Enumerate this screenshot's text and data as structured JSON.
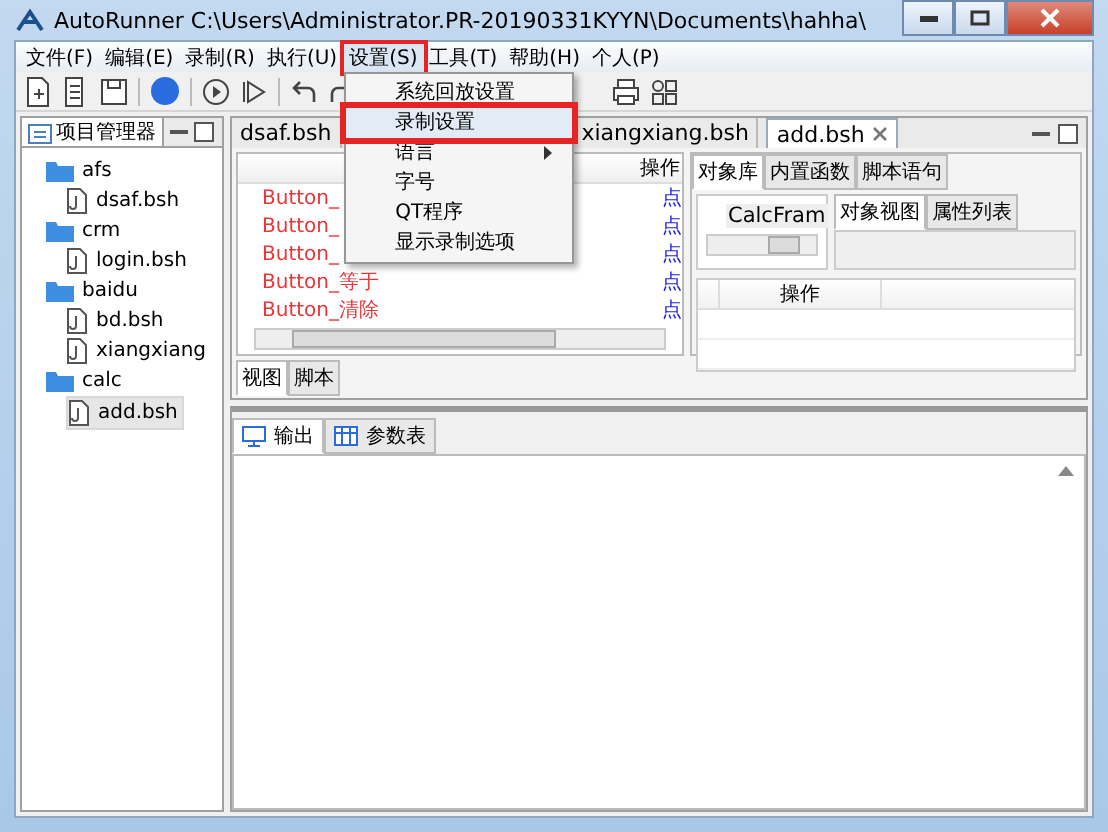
{
  "window": {
    "title": "AutoRunner  C:\\Users\\Administrator.PR-20190331KYYN\\Documents\\hahha\\"
  },
  "menu_bar": [
    {
      "label": "文件(F)",
      "selected": false
    },
    {
      "label": "编辑(E)",
      "selected": false
    },
    {
      "label": "录制(R)",
      "selected": false
    },
    {
      "label": "执行(U)",
      "selected": false
    },
    {
      "label": "设置(S)",
      "selected": true
    },
    {
      "label": "工具(T)",
      "selected": false
    },
    {
      "label": "帮助(H)",
      "selected": false
    },
    {
      "label": "个人(P)",
      "selected": false
    }
  ],
  "dropdown": [
    {
      "label": "系统回放设置",
      "selected": false,
      "submenu": false
    },
    {
      "label": "录制设置",
      "selected": true,
      "submenu": false
    },
    {
      "label": "语言",
      "selected": false,
      "submenu": true
    },
    {
      "label": "字号",
      "selected": false,
      "submenu": false
    },
    {
      "label": "QT程序",
      "selected": false,
      "submenu": false
    },
    {
      "label": "显示录制选项",
      "selected": false,
      "submenu": false
    }
  ],
  "project_panel": {
    "title": "项目管理器",
    "tree": [
      {
        "label": "afs",
        "kind": "folder",
        "selected": false,
        "children": [
          {
            "label": "dsaf.bsh",
            "kind": "file",
            "selected": false
          }
        ]
      },
      {
        "label": "crm",
        "kind": "folder",
        "selected": false,
        "children": [
          {
            "label": "login.bsh",
            "kind": "file",
            "selected": false
          }
        ]
      },
      {
        "label": "baidu",
        "kind": "folder",
        "selected": false,
        "children": [
          {
            "label": "bd.bsh",
            "kind": "file",
            "selected": false
          },
          {
            "label": "xiangxiang",
            "kind": "file",
            "selected": false
          }
        ]
      },
      {
        "label": "calc",
        "kind": "folder",
        "selected": false,
        "children": [
          {
            "label": "add.bsh",
            "kind": "file",
            "selected": true
          }
        ]
      }
    ]
  },
  "editor_tabs": [
    {
      "label": "dsaf.bsh",
      "selected": false,
      "closable": false
    },
    {
      "label": "xiangxiang.bsh",
      "selected": false,
      "closable": false
    },
    {
      "label": "add.bsh",
      "selected": true,
      "closable": true
    }
  ],
  "step_table": {
    "header": "操作",
    "rows": [
      {
        "name": "Button_",
        "action": "点"
      },
      {
        "name": "Button_",
        "action": "点"
      },
      {
        "name": "Button_",
        "action": "点"
      },
      {
        "name": "Button_等于",
        "action": "点"
      },
      {
        "name": "Button_清除",
        "action": "点"
      }
    ]
  },
  "object_tabs": [
    {
      "label": "对象库",
      "selected": true
    },
    {
      "label": "内置函数",
      "selected": false
    },
    {
      "label": "脚本语句",
      "selected": false
    }
  ],
  "object_tree": [
    "CalcFram"
  ],
  "view_tabs": [
    {
      "label": "对象视图",
      "selected": true
    },
    {
      "label": "属性列表",
      "selected": false
    }
  ],
  "action_table": {
    "header": "操作"
  },
  "mode_tabs": [
    {
      "label": "视图",
      "selected": true
    },
    {
      "label": "脚本",
      "selected": false
    }
  ],
  "output_tabs": [
    {
      "label": "输出",
      "kind": "output",
      "selected": true
    },
    {
      "label": "参数表",
      "kind": "table",
      "selected": false
    }
  ]
}
